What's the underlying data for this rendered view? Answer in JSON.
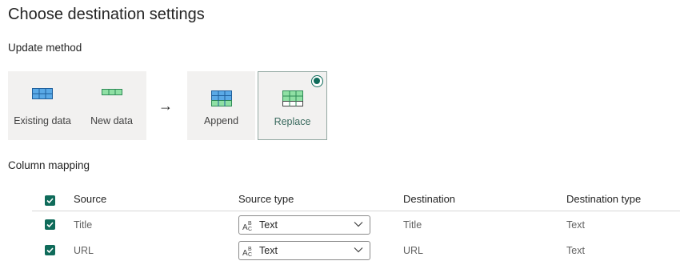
{
  "header": {
    "title": "Choose destination settings"
  },
  "update_method": {
    "label": "Update method",
    "source_tiles": [
      {
        "label": "Existing data",
        "icon": "existing-data-grid-icon"
      },
      {
        "label": "New data",
        "icon": "new-data-grid-icon"
      }
    ],
    "arrow": "→",
    "options": [
      {
        "label": "Append",
        "icon": "append-grid-icon",
        "selected": false
      },
      {
        "label": "Replace",
        "icon": "replace-grid-icon",
        "selected": true
      }
    ]
  },
  "column_mapping": {
    "label": "Column mapping",
    "headers": {
      "source": "Source",
      "source_type": "Source type",
      "destination": "Destination",
      "destination_type": "Destination type"
    },
    "rows": [
      {
        "checked": true,
        "source": "Title",
        "source_type": "Text",
        "destination": "Title",
        "destination_type": "Text"
      },
      {
        "checked": true,
        "source": "URL",
        "source_type": "Text",
        "destination": "URL",
        "destination_type": "Text"
      }
    ]
  },
  "colors": {
    "accent": "#0f6b5a",
    "blue_grid": "#5aa9e6",
    "green_grid": "#6ccf8a",
    "panel_bg": "#f2f1f0"
  }
}
